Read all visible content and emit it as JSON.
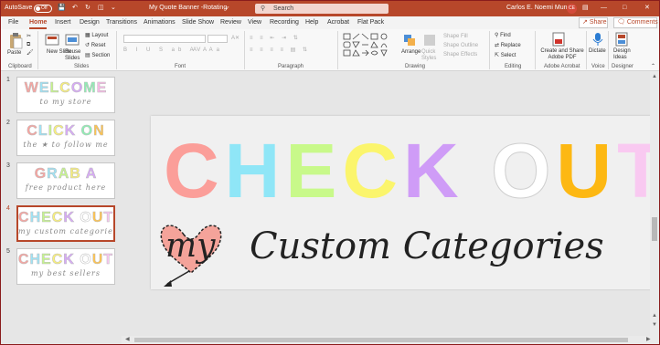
{
  "titlebar": {
    "autosave_label": "AutoSave",
    "autosave_state": "Off",
    "doc_title": "My Quote Banner -Rotating-",
    "search_placeholder": "Search",
    "user_name": "Carlos E. Noemi Munoz",
    "user_initials": "CE",
    "color": "#b7472a"
  },
  "tabs": [
    "File",
    "Home",
    "Insert",
    "Design",
    "Transitions",
    "Animations",
    "Slide Show",
    "Review",
    "View",
    "Recording",
    "Help",
    "Acrobat",
    "Flat Pack"
  ],
  "active_tab": "Home",
  "share_label": "Share",
  "comments_label": "Comments",
  "ribbon": {
    "clipboard": {
      "label": "Clipboard",
      "paste": "Paste"
    },
    "slides": {
      "label": "Slides",
      "new_slide": "New Slide",
      "reuse_slides": "Reuse Slides",
      "layout": "Layout",
      "reset": "Reset",
      "section": "Section"
    },
    "font": {
      "label": "Font"
    },
    "paragraph": {
      "label": "Paragraph"
    },
    "drawing": {
      "label": "Drawing",
      "arrange": "Arrange",
      "quick_styles": "Quick Styles",
      "shape_fill": "Shape Fill",
      "shape_outline": "Shape Outline",
      "shape_effects": "Shape Effects"
    },
    "editing": {
      "label": "Editing",
      "find": "Find",
      "replace": "Replace",
      "select": "Select"
    },
    "adobe": {
      "label": "Adobe Acrobat",
      "create_share": "Create and Share Adobe PDF"
    },
    "voice": {
      "label": "Voice",
      "dictate": "Dictate"
    },
    "designer": {
      "label": "Designer",
      "design_ideas": "Design Ideas"
    }
  },
  "slides": [
    {
      "number": "1",
      "title": "WELCOME",
      "subtitle": "to my store",
      "colors": [
        "#f7a4a0",
        "#9fe3f5",
        "#c6f58c",
        "#f9f07a",
        "#d7a9f7",
        "#8ef0b4",
        "#f8b8e6"
      ]
    },
    {
      "number": "2",
      "title": "CLICK ON",
      "subtitle": "the ★ to follow me",
      "colors": [
        "#f7a4a0",
        "#9fe3f5",
        "#c6f58c",
        "#f9f07a",
        "#d7a9f7",
        "#8ef0b4",
        "#ffc34d",
        "#8ef0b4"
      ]
    },
    {
      "number": "3",
      "title": "GRAB A",
      "subtitle": "free product here",
      "colors": [
        "#f7a4a0",
        "#9fe3f5",
        "#c6f58c",
        "#f9f07a",
        "#d7a9f7",
        "#8ef0b4"
      ]
    },
    {
      "number": "4",
      "title": "CHECK OUT",
      "subtitle": "my custom categories",
      "colors": [
        "#f7a4a0",
        "#9fe3f5",
        "#c6f58c",
        "#f9f07a",
        "#d7a9f7",
        "#ffffff",
        "#ffc34d",
        "#f8c6f0",
        "#8ef0b4"
      ]
    },
    {
      "number": "5",
      "title": "CHECK OUT",
      "subtitle": "my best sellers",
      "colors": [
        "#f7a4a0",
        "#9fe3f5",
        "#c6f58c",
        "#f9f07a",
        "#d7a9f7",
        "#ffffff",
        "#ffc34d",
        "#f8c6f0",
        "#8ef0b4"
      ]
    }
  ],
  "selected_slide": "4",
  "main_slide": {
    "headline": "CHECK OUT",
    "headline_colors": [
      "#fb9e99",
      "#8fe6f7",
      "#c8f98a",
      "#fbf56c",
      "#cf9cf7",
      "#ffffff",
      "#fdb813",
      "#f9c9f1",
      "#7ff2b0"
    ],
    "subline_word1": "my",
    "subline": "Custom Categories",
    "heart_color": "#f4a39a"
  }
}
